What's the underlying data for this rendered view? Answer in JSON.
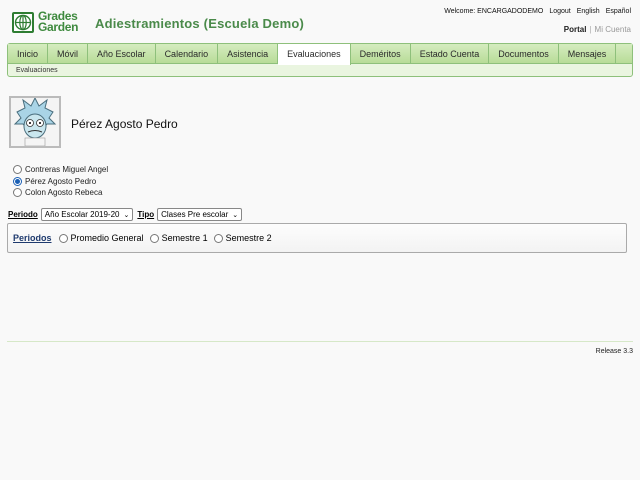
{
  "header": {
    "logo_line1": "Grades",
    "logo_line2": "Garden",
    "title": "Adiestramientos (Escuela Demo)",
    "welcome": "Welcome: ENCARGADODEMO",
    "logout": "Logout",
    "lang_en": "English",
    "lang_es": "Español",
    "portal": "Portal",
    "separator": "|",
    "my_account": "Mi Cuenta"
  },
  "nav": {
    "tabs": [
      "Inicio",
      "Móvil",
      "Año Escolar",
      "Calendario",
      "Asistencia",
      "Evaluaciones",
      "Deméritos",
      "Estado Cuenta",
      "Documentos",
      "Mensajes"
    ],
    "active_tab": "Evaluaciones",
    "subnav": "Evaluaciones"
  },
  "profile": {
    "name": "Pérez Agosto Pedro"
  },
  "students": [
    {
      "name": "Contreras Miguel Angel",
      "selected": false
    },
    {
      "name": "Pérez Agosto Pedro",
      "selected": true
    },
    {
      "name": "Colon Agosto Rebeca",
      "selected": false
    }
  ],
  "filters": {
    "period_label": "Periodo",
    "period_value": "Año Escolar 2019-20",
    "type_label": "Tipo",
    "type_value": "Clases Pre escolar"
  },
  "periods": {
    "label": "Periodos",
    "options": [
      "Promedio General",
      "Semestre 1",
      "Semestre 2"
    ]
  },
  "footer": {
    "release": "Release 3.3"
  },
  "colors": {
    "brand_green": "#4a8a4a",
    "nav_border": "#8ec07b",
    "radio_accent": "#1a5fb4"
  }
}
